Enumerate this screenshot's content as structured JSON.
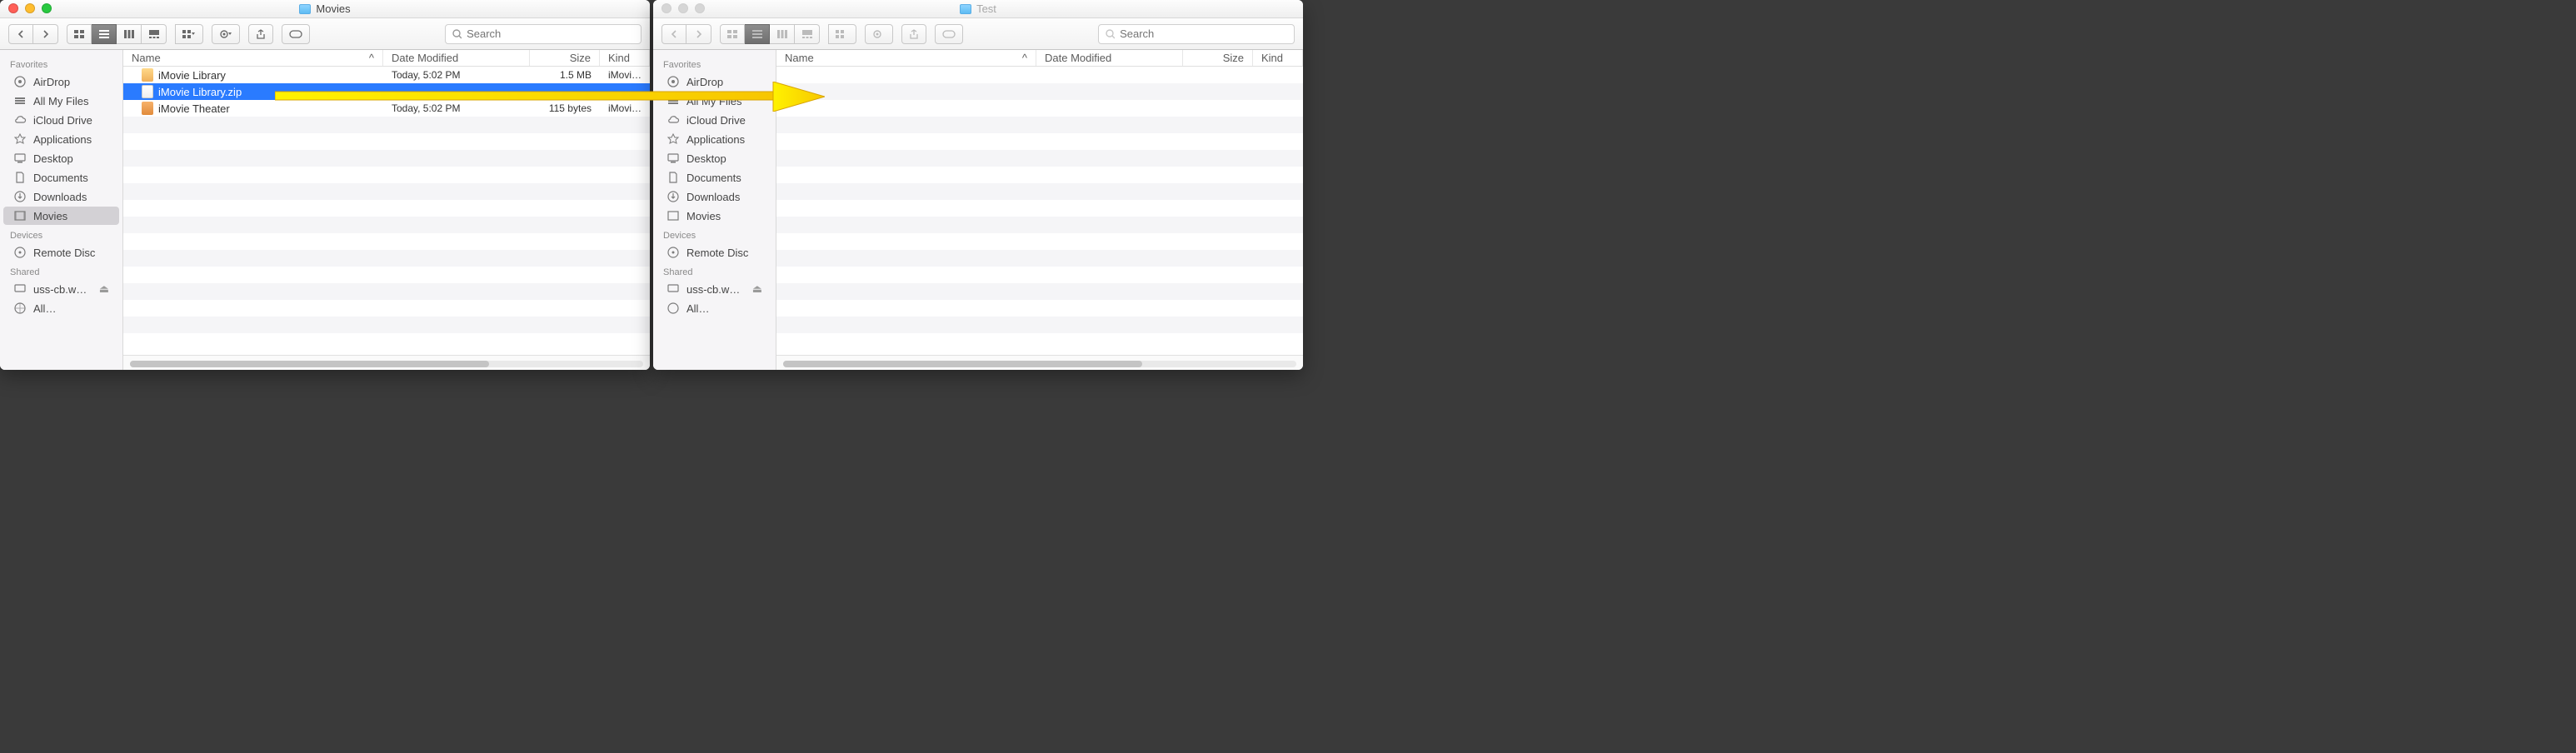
{
  "windows": [
    {
      "id": "win1",
      "title": "Movies",
      "active": true,
      "search_placeholder": "Search",
      "sidebar": {
        "favorites_label": "Favorites",
        "devices_label": "Devices",
        "shared_label": "Shared",
        "favorites": [
          {
            "icon": "airdrop",
            "label": "AirDrop"
          },
          {
            "icon": "allfiles",
            "label": "All My Files"
          },
          {
            "icon": "icloud",
            "label": "iCloud Drive"
          },
          {
            "icon": "apps",
            "label": "Applications"
          },
          {
            "icon": "desktop",
            "label": "Desktop"
          },
          {
            "icon": "docs",
            "label": "Documents"
          },
          {
            "icon": "downloads",
            "label": "Downloads"
          },
          {
            "icon": "movies",
            "label": "Movies",
            "active": true
          }
        ],
        "devices": [
          {
            "icon": "disc",
            "label": "Remote Disc"
          }
        ],
        "shared": [
          {
            "icon": "server",
            "label": "uss-cb.w…",
            "eject": true
          },
          {
            "icon": "globe",
            "label": "All…"
          }
        ]
      },
      "columns": {
        "name": "Name",
        "date": "Date Modified",
        "size": "Size",
        "kind": "Kind",
        "sort": "^"
      },
      "rows": [
        {
          "icon": "ico-lib",
          "name": "iMovie Library",
          "date": "Today, 5:02 PM",
          "size": "1.5 MB",
          "kind": "iMovi…",
          "selected": false
        },
        {
          "icon": "ico-zip",
          "name": "iMovie Library.zip",
          "date": "",
          "size": "",
          "kind": "",
          "selected": true
        },
        {
          "icon": "ico-theater",
          "name": "iMovie Theater",
          "date": "Today, 5:02 PM",
          "size": "115 bytes",
          "kind": "iMovi…",
          "selected": false
        }
      ]
    },
    {
      "id": "win2",
      "title": "Test",
      "active": false,
      "search_placeholder": "Search",
      "sidebar": {
        "favorites_label": "Favorites",
        "devices_label": "Devices",
        "shared_label": "Shared",
        "favorites": [
          {
            "icon": "airdrop",
            "label": "AirDrop"
          },
          {
            "icon": "allfiles",
            "label": "All My Files"
          },
          {
            "icon": "icloud",
            "label": "iCloud Drive"
          },
          {
            "icon": "apps",
            "label": "Applications"
          },
          {
            "icon": "desktop",
            "label": "Desktop"
          },
          {
            "icon": "docs",
            "label": "Documents"
          },
          {
            "icon": "downloads",
            "label": "Downloads"
          },
          {
            "icon": "movies",
            "label": "Movies"
          }
        ],
        "devices": [
          {
            "icon": "disc",
            "label": "Remote Disc"
          }
        ],
        "shared": [
          {
            "icon": "server",
            "label": "uss-cb.w…",
            "eject": true
          },
          {
            "icon": "globe",
            "label": "All…"
          }
        ]
      },
      "columns": {
        "name": "Name",
        "date": "Date Modified",
        "size": "Size",
        "kind": "Kind",
        "sort": "^"
      },
      "rows": []
    }
  ]
}
